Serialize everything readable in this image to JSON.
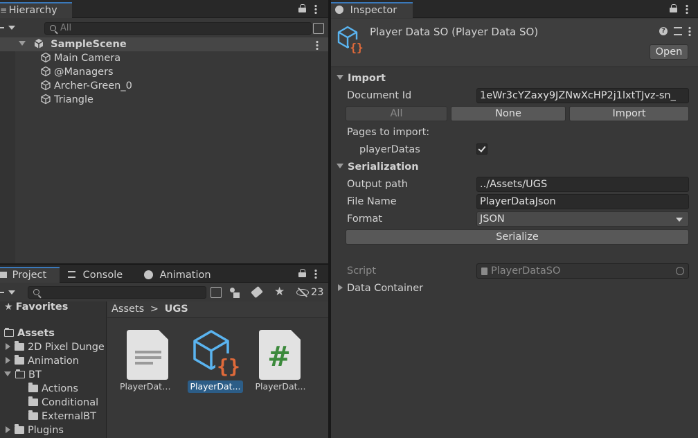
{
  "hierarchy": {
    "tab_label": "Hierarchy",
    "search_placeholder": "All",
    "scene": "SampleScene",
    "objects": [
      "Main Camera",
      "@Managers",
      "Archer-Green_0",
      "Triangle"
    ]
  },
  "project": {
    "tabs": [
      "Project",
      "Console",
      "Animation"
    ],
    "hidden_count": "23",
    "favorites_label": "Favorites",
    "tree": {
      "assets": "Assets",
      "items": [
        "2D Pixel Dunge",
        "Animation",
        "BT",
        "Plugins"
      ],
      "bt_children": [
        "Actions",
        "Conditional",
        "ExternalBT"
      ]
    },
    "breadcrumb": {
      "root": "Assets",
      "separator": ">",
      "current": "UGS"
    },
    "assets": [
      {
        "name": "PlayerData...",
        "kind": "text-icon"
      },
      {
        "name": "PlayerDat...",
        "kind": "scriptable-object-icon",
        "selected": true
      },
      {
        "name": "PlayerDat...",
        "kind": "csharp-script-icon"
      }
    ]
  },
  "inspector": {
    "tab_label": "Inspector",
    "title": "Player Data SO (Player Data SO)",
    "open_label": "Open",
    "import_section": "Import",
    "document_id_label": "Document Id",
    "document_id_value": "1eWr3cYZaxy9JZNwXcHP2j1lxtTJvz-sn_",
    "btn_all": "All",
    "btn_none": "None",
    "btn_import": "Import",
    "pages_label": "Pages to import:",
    "page_name": "playerDatas",
    "serialization_section": "Serialization",
    "output_path_label": "Output path",
    "output_path_value": "../Assets/UGS",
    "file_name_label": "File Name",
    "file_name_value": "PlayerDataJson",
    "format_label": "Format",
    "format_value": "JSON",
    "serialize_label": "Serialize",
    "script_label": "Script",
    "script_value": "PlayerDataSO",
    "data_container_label": "Data Container"
  },
  "colors": {
    "accent": "#3a79bb",
    "selection": "#2c5d87",
    "so_icon_blue": "#5ab4f0",
    "so_icon_orange": "#e06a3a",
    "csharp_green": "#3c8a3c"
  }
}
